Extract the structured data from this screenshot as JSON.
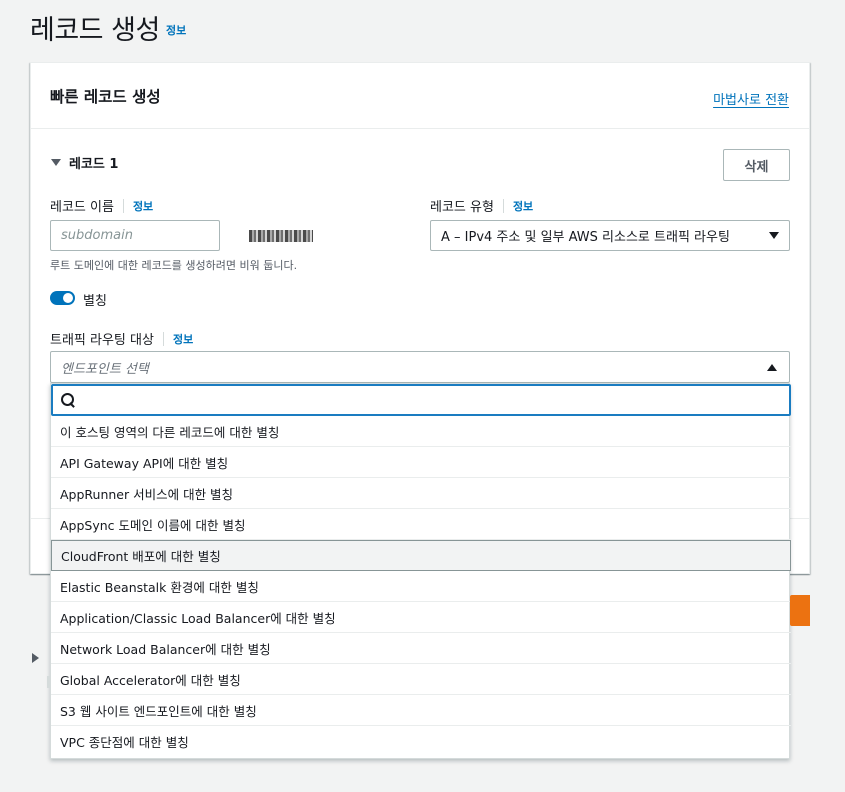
{
  "page": {
    "title": "레코드 생성",
    "info": "정보"
  },
  "card": {
    "title": "빠른 레코드 생성",
    "wizard_link": "마법사로 전환"
  },
  "record": {
    "section_label": "레코드 1",
    "delete_label": "삭제",
    "name_label": "레코드 이름",
    "name_info": "정보",
    "name_placeholder": "subdomain",
    "name_helper": "루트 도메인에 대한 레코드를 생성하려면 비워 둡니다.",
    "type_label": "레코드 유형",
    "type_info": "정보",
    "type_value": "A – IPv4 주소 및 일부 AWS 리소스로 트래픽 라우팅",
    "alias_label": "별칭",
    "alias_enabled": true,
    "target_label": "트래픽 라우팅 대상",
    "target_info": "정보",
    "target_placeholder": "엔드포인트 선택"
  },
  "dropdown": {
    "search_value": "",
    "options": [
      "이 호스팅 영역의 다른 레코드에 대한 별칭",
      "API Gateway API에 대한 별칭",
      "AppRunner 서비스에 대한 별칭",
      "AppSync 도메인 이름에 대한 별칭",
      "CloudFront 배포에 대한 별칭",
      "Elastic Beanstalk 환경에 대한 별칭",
      "Application/Classic Load Balancer에 대한 별칭",
      "Network Load Balancer에 대한 별칭",
      "Global Accelerator에 대한 별칭",
      "S3 웹 사이트 엔드포인트에 대한 별칭",
      "VPC 종단점에 대한 별칭"
    ],
    "highlighted_index": 4
  },
  "colors": {
    "accent": "#0073bb",
    "primary_button": "#ec7211"
  }
}
